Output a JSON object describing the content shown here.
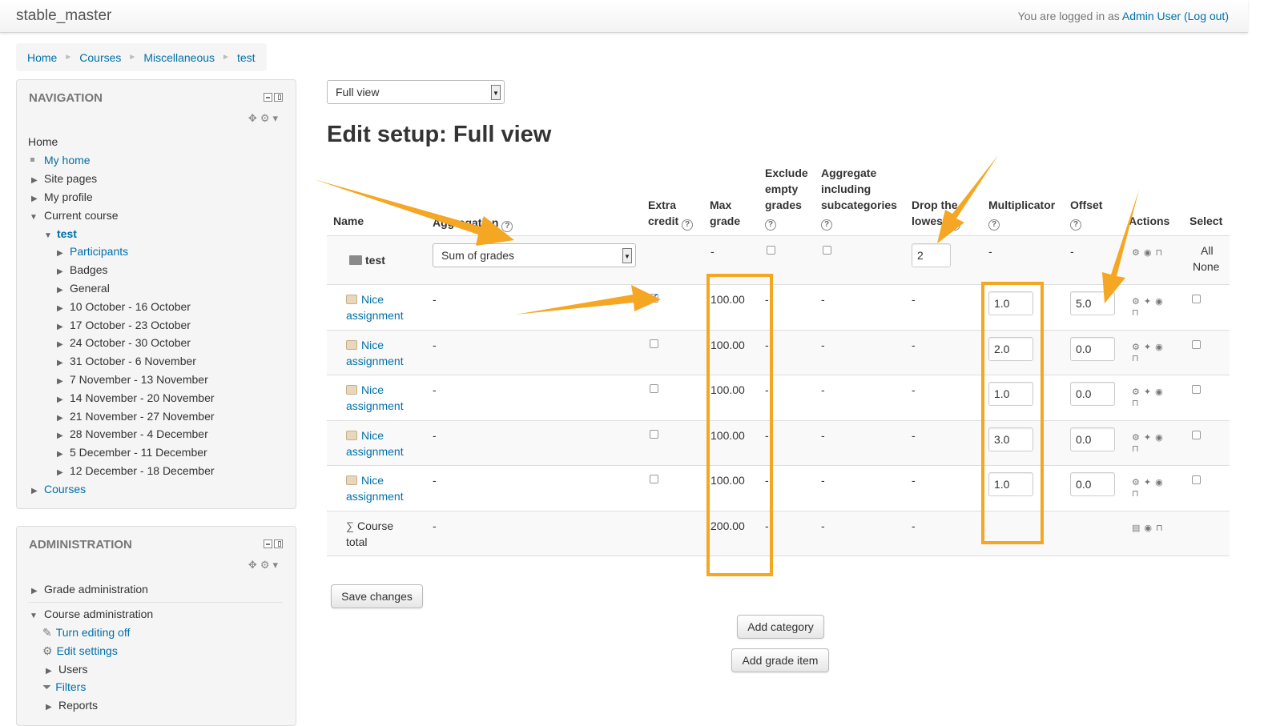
{
  "header": {
    "site_name": "stable_master",
    "login_prefix": "You are logged in as",
    "user_name": "Admin User",
    "logout_label": "(Log out)"
  },
  "breadcrumb": [
    "Home",
    "Courses",
    "Miscellaneous",
    "test"
  ],
  "navigation": {
    "title": "NAVIGATION",
    "home": "Home",
    "items": [
      "My home",
      "Site pages",
      "My profile",
      "Current course",
      "test",
      "Participants",
      "Badges",
      "General",
      "10 October - 16 October",
      "17 October - 23 October",
      "24 October - 30 October",
      "31 October - 6 November",
      "7 November - 13 November",
      "14 November - 20 November",
      "21 November - 27 November",
      "28 November - 4 December",
      "5 December - 11 December",
      "12 December - 18 December",
      "Courses"
    ]
  },
  "administration": {
    "title": "ADMINISTRATION",
    "items": [
      "Grade administration",
      "Course administration",
      "Turn editing off",
      "Edit settings",
      "Users",
      "Filters",
      "Reports"
    ]
  },
  "main": {
    "view_select": "Full view",
    "title": "Edit setup: Full view",
    "columns": {
      "name": "Name",
      "aggregation": "Aggregation",
      "extra_credit_1": "Extra",
      "extra_credit_2": "credit",
      "max_grade_1": "Max",
      "max_grade_2": "grade",
      "exclude_1": "Exclude",
      "exclude_2": "empty",
      "exclude_3": "grades",
      "aggregate_1": "Aggregate",
      "aggregate_2": "including",
      "aggregate_3": "subcategories",
      "drop_1": "Drop the",
      "drop_2": "lowest",
      "multiplicator": "Multiplicator",
      "offset": "Offset",
      "actions": "Actions",
      "select": "Select"
    },
    "category_row": {
      "name": "test",
      "aggregation": "Sum of grades",
      "max_grade": "-",
      "drop_lowest": "2",
      "multiplicator": "-",
      "offset": "-",
      "select_all": "All",
      "select_none": "None"
    },
    "items": [
      {
        "name_1": "Nice",
        "name_2": "assignment",
        "aggregation": "-",
        "extra_credit": true,
        "max_grade": "100.00",
        "exclude": "-",
        "aggregate": "-",
        "drop": "-",
        "multiplicator": "1.0",
        "offset": "5.0"
      },
      {
        "name_1": "Nice",
        "name_2": "assignment",
        "aggregation": "-",
        "extra_credit": false,
        "max_grade": "100.00",
        "exclude": "-",
        "aggregate": "-",
        "drop": "-",
        "multiplicator": "2.0",
        "offset": "0.0"
      },
      {
        "name_1": "Nice",
        "name_2": "assignment",
        "aggregation": "-",
        "extra_credit": false,
        "max_grade": "100.00",
        "exclude": "-",
        "aggregate": "-",
        "drop": "-",
        "multiplicator": "1.0",
        "offset": "0.0"
      },
      {
        "name_1": "Nice",
        "name_2": "assignment",
        "aggregation": "-",
        "extra_credit": false,
        "max_grade": "100.00",
        "exclude": "-",
        "aggregate": "-",
        "drop": "-",
        "multiplicator": "3.0",
        "offset": "0.0"
      },
      {
        "name_1": "Nice",
        "name_2": "assignment",
        "aggregation": "-",
        "extra_credit": false,
        "max_grade": "100.00",
        "exclude": "-",
        "aggregate": "-",
        "drop": "-",
        "multiplicator": "1.0",
        "offset": "0.0"
      }
    ],
    "total_row": {
      "name_1": "Course",
      "name_2": "total",
      "aggregation": "-",
      "max_grade": "200.00",
      "exclude": "-",
      "aggregate": "-",
      "drop": "-"
    },
    "buttons": {
      "save": "Save changes",
      "add_category": "Add category",
      "add_grade_item": "Add grade item"
    }
  },
  "colors": {
    "link": "#0070a8",
    "highlight": "#f5a623"
  }
}
